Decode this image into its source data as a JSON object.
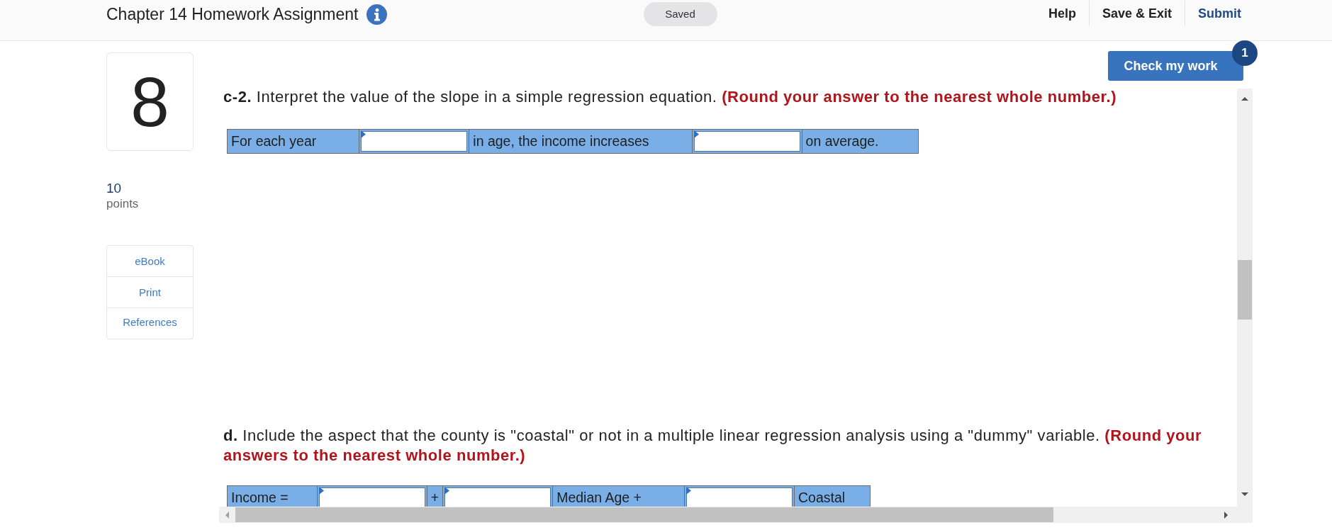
{
  "header": {
    "title": "Chapter 14 Homework Assignment",
    "save_status": "Saved",
    "actions": [
      {
        "label": "Help",
        "kind": "plain"
      },
      {
        "label": "Save & Exit",
        "kind": "plain"
      },
      {
        "label": "Submit",
        "kind": "primary"
      }
    ]
  },
  "question": {
    "number": "8",
    "points": "10",
    "points_label": "points"
  },
  "resources": [
    {
      "label": "eBook"
    },
    {
      "label": "Print"
    },
    {
      "label": "References"
    }
  ],
  "check_button": {
    "label": "Check my work",
    "badge": "1"
  },
  "parts": [
    {
      "label": "c-2.",
      "text": "Interpret the value of the slope in a simple regression equation.",
      "instruction": "(Round your answer to the nearest whole number.)",
      "answer_row": [
        {
          "kind": "text",
          "text": "For each year"
        },
        {
          "kind": "input"
        },
        {
          "kind": "text",
          "text": "in age, the income increases"
        },
        {
          "kind": "input"
        },
        {
          "kind": "text",
          "text": "on average."
        }
      ]
    },
    {
      "label": "d.",
      "text": "Include the aspect that the county is \"coastal\" or not in a multiple linear regression analysis using a \"dummy\" variable.",
      "instruction": "(Round your answers to the nearest whole number.)",
      "answer_row": [
        {
          "kind": "text",
          "text": "Income ="
        },
        {
          "kind": "input"
        },
        {
          "kind": "text",
          "text": "+"
        },
        {
          "kind": "input"
        },
        {
          "kind": "text",
          "text": "Median Age +"
        },
        {
          "kind": "input"
        },
        {
          "kind": "text",
          "text": "Coastal"
        }
      ]
    }
  ]
}
